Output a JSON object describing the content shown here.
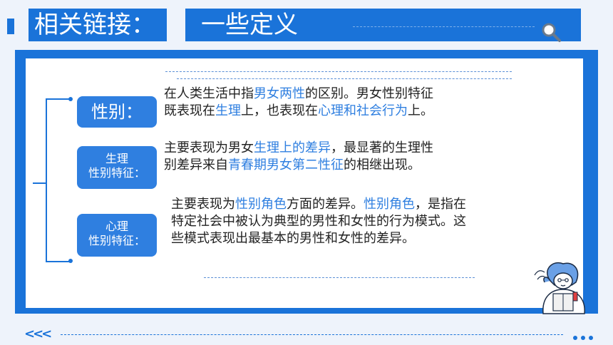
{
  "header": {
    "badge": "相关链接：",
    "title": "一些定义"
  },
  "labels": {
    "gender": "性别：",
    "physiological_line1": "生理",
    "physiological_line2": "性别特征：",
    "psychological_line1": "心理",
    "psychological_line2": "性别特征："
  },
  "para1": [
    "在人类生活中指",
    "男女两性",
    "的区别。男女性别特征",
    "既表现在",
    "生理",
    "上，也表现在",
    "心理和社会行为",
    "上。"
  ],
  "para2": [
    "主要表现为男女",
    "生理上的差异",
    "，最显著的生理性",
    "别差异来自",
    "青春期男女第二性征",
    "的相继出现。"
  ],
  "para3": [
    "主要表现为",
    "性别角色",
    "方面的差异。",
    "性别角色",
    "，是指在",
    "特定社会中被认为典型的男性和女性的行为模式。这",
    "些模式表现出最基本的男性和女性的差异。"
  ],
  "footer": {
    "arrows": "<<<"
  },
  "colors": {
    "accent": "#1a73d9",
    "highlight": "#2f7fe0"
  },
  "icons": [
    "magnifier-icon",
    "reading-girl-illustration"
  ]
}
